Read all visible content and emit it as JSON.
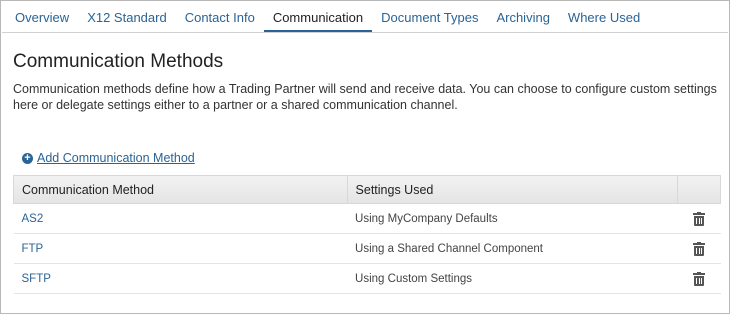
{
  "tabs": [
    {
      "label": "Overview",
      "active": false
    },
    {
      "label": "X12 Standard",
      "active": false
    },
    {
      "label": "Contact Info",
      "active": false
    },
    {
      "label": "Communication",
      "active": true
    },
    {
      "label": "Document Types",
      "active": false
    },
    {
      "label": "Archiving",
      "active": false
    },
    {
      "label": "Where Used",
      "active": false
    }
  ],
  "page": {
    "title": "Communication Methods",
    "description": "Communication methods define how a Trading Partner will send and receive data. You can choose to configure custom settings here or delegate settings either to a partner or a shared communication channel.",
    "add_label": "Add Communication Method"
  },
  "table": {
    "headers": [
      "Communication Method",
      "Settings Used",
      ""
    ],
    "rows": [
      {
        "method": "AS2",
        "settings": "Using MyCompany Defaults",
        "action_icon": "trash-icon"
      },
      {
        "method": "FTP",
        "settings": "Using a Shared Channel Component",
        "action_icon": "trash-icon"
      },
      {
        "method": "SFTP",
        "settings": "Using Custom Settings",
        "action_icon": "trash-icon"
      }
    ]
  },
  "colors": {
    "link": "#2a6496",
    "active_underline": "#2a6496"
  }
}
